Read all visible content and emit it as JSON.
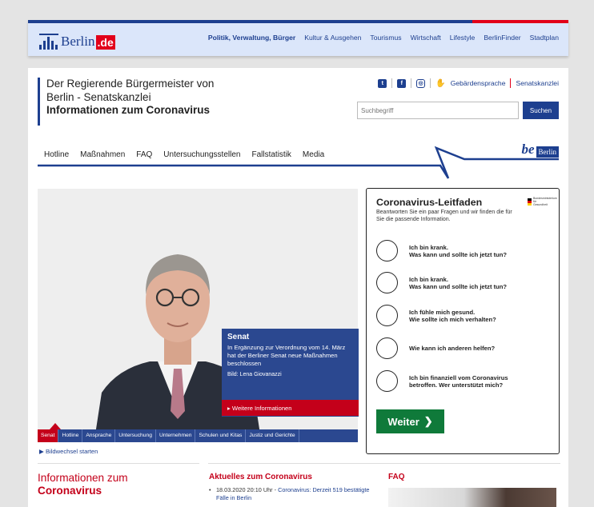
{
  "portal": {
    "logo_word": "Berlin",
    "logo_de": ".de",
    "nav": [
      {
        "label": "Politik, Verwaltung, Bürger",
        "bold": true
      },
      {
        "label": "Kultur & Ausgehen",
        "bold": false
      },
      {
        "label": "Tourismus",
        "bold": false
      },
      {
        "label": "Wirtschaft",
        "bold": false
      },
      {
        "label": "Lifestyle",
        "bold": false
      },
      {
        "label": "BerlinFinder",
        "bold": false
      },
      {
        "label": "Stadtplan",
        "bold": false
      }
    ]
  },
  "header": {
    "line1": "Der Regierende Bürgermeister von",
    "line2": "Berlin - Senatskanzlei",
    "line3": "Informationen zum Coronavirus",
    "gebaerdensprache": "Gebärdensprache",
    "senatskanzlei": "Senatskanzlei",
    "search_placeholder": "Suchbegriff",
    "search_button": "Suchen",
    "be_text": "be",
    "berlin_text": "Berlin"
  },
  "mainnav": [
    "Hotline",
    "Maßnahmen",
    "FAQ",
    "Untersuchungsstellen",
    "Fallstatistik",
    "Media"
  ],
  "hero": {
    "title": "Senat",
    "text": "In Ergänzung zur Verordnung vom 14. März hat der Berliner Senat neue Maßnahmen beschlossen",
    "credit": "Bild: Lena Giovanazzi",
    "more": "▸ Weitere Informationen",
    "tabs": [
      "Senat",
      "Hotline",
      "Ansprache",
      "Untersuchung",
      "Unternehmen",
      "Schulen und Kitas",
      "Justiz und Gerichte"
    ],
    "slideshow": "▶ Bildwechsel starten"
  },
  "leitfaden": {
    "title": "Coronavirus-Leitfaden",
    "intro": "Beantworten Sie ein paar Fragen und wir finden die für Sie die passende Information.",
    "ministry": "Bundesministerium für Gesundheit",
    "options": [
      {
        "l1": "Ich bin krank.",
        "l2": "Was kann und sollte ich jetzt tun?"
      },
      {
        "l1": "Ich bin krank.",
        "l2": "Was kann und sollte ich jetzt tun?"
      },
      {
        "l1": "Ich fühle mich gesund.",
        "l2": "Wie sollte ich mich verhalten?"
      },
      {
        "l1": "Wie kann ich anderen helfen?",
        "l2": ""
      },
      {
        "l1": "Ich bin finanziell vom Coronavirus",
        "l2": "betroffen. Wer unterstützt mich?"
      }
    ],
    "weiter": "Weiter"
  },
  "bottom": {
    "info_line1": "Informationen zum",
    "info_line2": "Coronavirus",
    "aktuelles_title": "Aktuelles zum Coronavirus",
    "news_date": "18.03.2020 20:10 Uhr - ",
    "news_link": "Coronavirus: Derzeit 519 bestätigte Fälle in Berlin",
    "faq_title": "FAQ"
  },
  "colors": {
    "brand_blue": "#1d3f8f",
    "accent_red": "#c4001a",
    "weiter_green": "#0f7a3a"
  }
}
